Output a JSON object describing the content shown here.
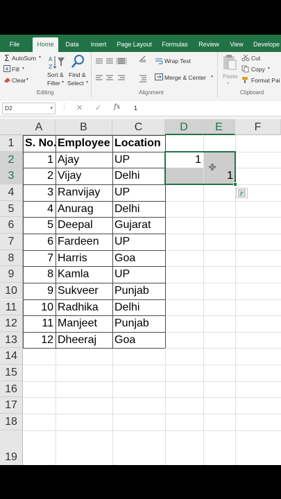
{
  "tabs": [
    "File",
    "Home",
    "Data",
    "Insert",
    "Page Layout",
    "Formulas",
    "Review",
    "View",
    "Develope"
  ],
  "active_tab": "Home",
  "ribbon": {
    "autosum": "AutoSum",
    "fill": "Fill",
    "clear": "Clear",
    "sort_filter_1": "Sort &",
    "sort_filter_2": "Filter",
    "find_select_1": "Find &",
    "find_select_2": "Select",
    "editing_label": "Editing",
    "wrap_text": "Wrap Text",
    "merge_center": "Merge & Center",
    "alignment_label": "Alignment",
    "paste": "Paste",
    "cut": "Cut",
    "copy": "Copy",
    "format_painter": "Format Pai",
    "clipboard_label": "Clipboard"
  },
  "formula_bar": {
    "name_box": "D2",
    "fx": "fx",
    "value": "1"
  },
  "columns": [
    "A",
    "B",
    "C",
    "D",
    "E",
    "F"
  ],
  "rows": [
    "1",
    "2",
    "3",
    "4",
    "5",
    "6",
    "7",
    "8",
    "9",
    "10",
    "11",
    "12",
    "13",
    "14",
    "15",
    "16",
    "17",
    "18",
    "19"
  ],
  "headers": [
    "S. No.",
    "Employee",
    "Location"
  ],
  "table": [
    [
      "1",
      "Ajay",
      "UP"
    ],
    [
      "2",
      "Vijay",
      "Delhi"
    ],
    [
      "3",
      "Ranvijay",
      "UP"
    ],
    [
      "4",
      "Anurag",
      "Delhi"
    ],
    [
      "5",
      "Deepal",
      "Gujarat"
    ],
    [
      "6",
      "Fardeen",
      "UP"
    ],
    [
      "7",
      "Harris",
      "Goa"
    ],
    [
      "8",
      "Kamla",
      "UP"
    ],
    [
      "9",
      "Sukveer",
      "Punjab"
    ],
    [
      "10",
      "Radhika",
      "Delhi"
    ],
    [
      "11",
      "Manjeet",
      "Punjab"
    ],
    [
      "12",
      "Dheeraj",
      "Goa"
    ]
  ],
  "d2_value": "1",
  "e3_value": "1",
  "colors": {
    "excel_green": "#217346",
    "selection_shade": "#cdcdcd"
  }
}
